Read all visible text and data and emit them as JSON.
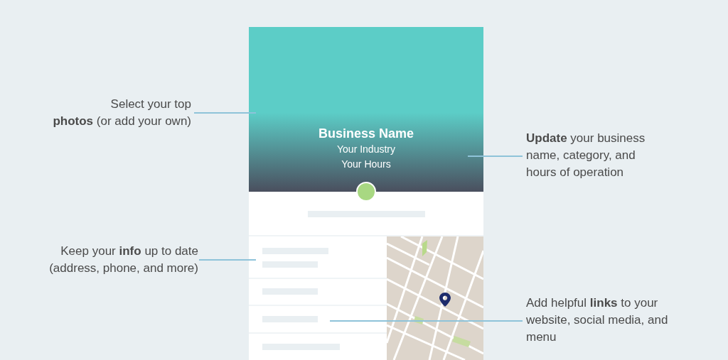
{
  "profile": {
    "business_name": "Business Name",
    "industry": "Your Industry",
    "hours": "Your Hours"
  },
  "annotations": [
    {
      "kind": "left",
      "text": "Select your top\n**photos** (or add your own)"
    },
    {
      "kind": "left",
      "text": "Keep your **info** up to date\n(address, phone, and more)"
    },
    {
      "kind": "right",
      "text": "**Update** your business\nname, category, and\nhours of operation"
    },
    {
      "kind": "right",
      "text": "Add helpful **links** to your\nwebsite, social media, and\nmenu"
    }
  ]
}
